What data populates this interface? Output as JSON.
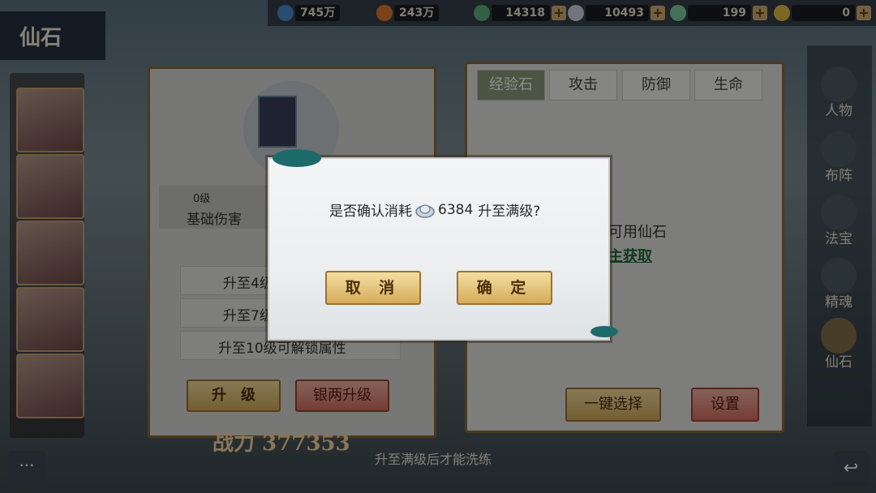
{
  "screen_title": "仙石",
  "resources": [
    {
      "name": "resource-1",
      "value": "745万",
      "icon": "drop-icon",
      "color": "#4a8ad0",
      "has_plus": false
    },
    {
      "name": "resource-2",
      "value": "243万",
      "icon": "fire-drop-icon",
      "color": "#e07a30",
      "has_plus": false
    },
    {
      "name": "resource-3",
      "value": "14318",
      "icon": "gourd-icon",
      "color": "#5fb07a",
      "has_plus": true
    },
    {
      "name": "resource-4",
      "value": "10493",
      "icon": "silver-ingot-icon",
      "color": "#cfd6e0",
      "has_plus": true
    },
    {
      "name": "resource-5",
      "value": "199",
      "icon": "gem-icon",
      "color": "#7ad0a0",
      "has_plus": true
    },
    {
      "name": "resource-6",
      "value": "0",
      "icon": "yellow-gem-icon",
      "color": "#e0c040",
      "has_plus": true
    }
  ],
  "left_panel": {
    "level": "0级",
    "base_damage": "基础伤害",
    "unlock_rows": [
      "升至4级",
      "升至7级",
      "升至10级可解锁属性"
    ],
    "upgrade_button": "升　级",
    "silver_upgrade_button": "银两升级"
  },
  "right_panel": {
    "tabs": [
      {
        "label": "经验石",
        "active": true
      },
      {
        "label": "攻击",
        "active": false
      },
      {
        "label": "防御",
        "active": false
      },
      {
        "label": "生命",
        "active": false
      }
    ],
    "text_available": "可用仙石",
    "link_get": "主获取",
    "select_all_button": "一键选择",
    "settings_button": "设置"
  },
  "side_menu": [
    "人物",
    "布阵",
    "法宝",
    "精魂",
    "仙石"
  ],
  "bottom_hint": "升至满级后才能洗练",
  "power_text": "战力 377353",
  "dialog": {
    "prefix": "是否确认消耗",
    "cost": "6384",
    "suffix": "升至满级?",
    "currency_icon": "silver-ingot-icon",
    "cancel": "取 消",
    "confirm": "确 定"
  },
  "colors": {
    "button_gold": "#e6c47c",
    "link_green": "#1e6b3c",
    "tab_active": "#8a9a7a"
  }
}
